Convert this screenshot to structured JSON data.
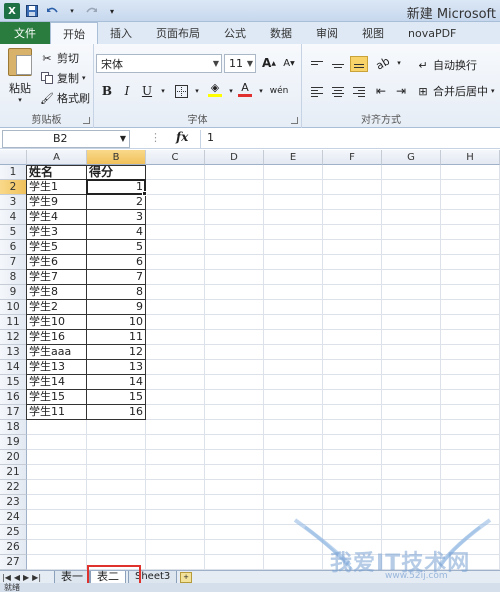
{
  "window": {
    "title": "新建 Microsoft"
  },
  "qat": {
    "app_icon": "X",
    "save_icon": "save-icon",
    "undo_icon": "undo-icon",
    "redo_icon": "redo-icon"
  },
  "ribbon_tabs": [
    {
      "label": "文件"
    },
    {
      "label": "开始"
    },
    {
      "label": "插入"
    },
    {
      "label": "页面布局"
    },
    {
      "label": "公式"
    },
    {
      "label": "数据"
    },
    {
      "label": "审阅"
    },
    {
      "label": "视图"
    },
    {
      "label": "novaPDF"
    }
  ],
  "clipboard": {
    "paste": "粘贴",
    "cut": "剪切",
    "copy": "复制",
    "format_painter": "格式刷",
    "group_label": "剪贴板"
  },
  "font": {
    "name": "宋体",
    "size": "11",
    "bold": "B",
    "italic": "I",
    "underline": "U",
    "grow": "A",
    "shrink": "A",
    "wen": "wén",
    "group_label": "字体"
  },
  "alignment": {
    "wrap_text": "自动换行",
    "merge_center": "合并后居中",
    "group_label": "对齐方式"
  },
  "formula_bar": {
    "name_box": "B2",
    "fx": "fx",
    "value": "1"
  },
  "columns": [
    "A",
    "B",
    "C",
    "D",
    "E",
    "F",
    "G",
    "H"
  ],
  "rows": [
    "1",
    "2",
    "3",
    "4",
    "5",
    "6",
    "7",
    "8",
    "9",
    "10",
    "11",
    "12",
    "13",
    "14",
    "15",
    "16",
    "17",
    "18",
    "19",
    "20",
    "21",
    "22",
    "23",
    "24",
    "25",
    "26",
    "27"
  ],
  "table": {
    "header": [
      "姓名",
      "得分"
    ],
    "rows": [
      [
        "学生1",
        "1"
      ],
      [
        "学生9",
        "2"
      ],
      [
        "学生4",
        "3"
      ],
      [
        "学生3",
        "4"
      ],
      [
        "学生5",
        "5"
      ],
      [
        "学生6",
        "6"
      ],
      [
        "学生7",
        "7"
      ],
      [
        "学生8",
        "8"
      ],
      [
        "学生2",
        "9"
      ],
      [
        "学生10",
        "10"
      ],
      [
        "学生16",
        "11"
      ],
      [
        "学生aaa",
        "12"
      ],
      [
        "学生13",
        "13"
      ],
      [
        "学生14",
        "14"
      ],
      [
        "学生15",
        "15"
      ],
      [
        "学生11",
        "16"
      ]
    ]
  },
  "sheets": {
    "tabs": [
      "表一",
      "表二",
      "Sheet3"
    ],
    "active": "表二"
  },
  "status": {
    "text": "就绪"
  },
  "watermark": {
    "text": "我爱IT技术网",
    "url": "www.52ij.com"
  }
}
